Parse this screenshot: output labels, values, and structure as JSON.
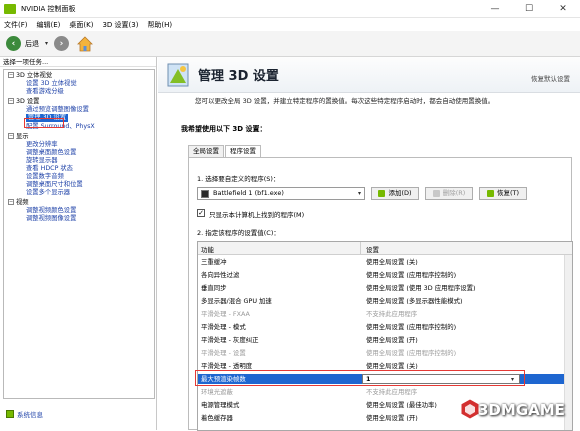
{
  "window": {
    "title": "NVIDIA 控制面板"
  },
  "menu": [
    "文件(F)",
    "编辑(E)",
    "桌面(K)",
    "3D 设置(3)",
    "帮助(H)"
  ],
  "toolbar": {
    "back_label": "后退"
  },
  "sidebar": {
    "header": "选择一项任务...",
    "items": [
      {
        "label": "3D 立体视觉",
        "kind": "cat"
      },
      {
        "label": "设置 3D 立体视觉",
        "kind": "leaf"
      },
      {
        "label": "查看游戏分级",
        "kind": "leaf"
      },
      {
        "label": "3D 设置",
        "kind": "cat"
      },
      {
        "label": "通过预览调整图像设置",
        "kind": "leaf"
      },
      {
        "label": "管理 3D 设置",
        "kind": "selected"
      },
      {
        "label": "配置 Surround、PhysX",
        "kind": "leaf"
      },
      {
        "label": "显示",
        "kind": "cat"
      },
      {
        "label": "更改分辨率",
        "kind": "leaf"
      },
      {
        "label": "调整桌面颜色设置",
        "kind": "leaf"
      },
      {
        "label": "旋转显示器",
        "kind": "leaf"
      },
      {
        "label": "查看 HDCP 状态",
        "kind": "leaf"
      },
      {
        "label": "设置数字音频",
        "kind": "leaf"
      },
      {
        "label": "调整桌面尺寸和位置",
        "kind": "leaf"
      },
      {
        "label": "设置多个显示器",
        "kind": "leaf"
      },
      {
        "label": "视频",
        "kind": "cat"
      },
      {
        "label": "调整视频颜色设置",
        "kind": "leaf"
      },
      {
        "label": "调整视频图像设置",
        "kind": "leaf"
      }
    ],
    "system_info": "系统信息"
  },
  "page": {
    "title": "管理 3D 设置",
    "restore_defaults": "恢复默认设置",
    "description": "您可以更改全局 3D 设置，并建立特定程序的置换值。每次这些特定程序启动时，都会自动使用置换值。",
    "section_title": "我希望使用以下 3D 设置：",
    "tabs": [
      "全局设置",
      "程序设置"
    ],
    "step1_label": "1. 选择要自定义的程序(S)：",
    "program_selected": "Battlefield 1 (bf1.exe)",
    "add_button": "添加(D)",
    "remove_button": "删除(R)",
    "restore_button": "恢复(T)",
    "only_found_checkbox": "只显示本计算机上找到的程序(M)",
    "step2_label": "2. 指定该程序的设置值(C)：",
    "grid_headers": {
      "feature": "功能",
      "setting": "设置"
    },
    "rows": [
      {
        "feature": "三重缓冲",
        "setting": "使用全局设置 (关)",
        "dim": false
      },
      {
        "feature": "各向异性过滤",
        "setting": "使用全局设置 (应用程序控制的)",
        "dim": false
      },
      {
        "feature": "垂直同步",
        "setting": "使用全局设置 (使用 3D 应用程序设置)",
        "dim": false
      },
      {
        "feature": "多显示器/混合 GPU 加速",
        "setting": "使用全局设置 (多显示器性能模式)",
        "dim": false
      },
      {
        "feature": "平滑处理 - FXAA",
        "setting": "不支持此应用程序",
        "dim": true
      },
      {
        "feature": "平滑处理 - 模式",
        "setting": "使用全局设置 (应用程序控制的)",
        "dim": false
      },
      {
        "feature": "平滑处理 - 灰度纠正",
        "setting": "使用全局设置 (开)",
        "dim": false
      },
      {
        "feature": "平滑处理 - 设置",
        "setting": "使用全局设置 (应用程序控制的)",
        "dim": true
      },
      {
        "feature": "平滑处理 - 透明度",
        "setting": "使用全局设置 (关)",
        "dim": false
      },
      {
        "feature": "最大预渲染帧数",
        "setting": "1",
        "dim": false,
        "selected": true
      },
      {
        "feature": "环境光遮蔽",
        "setting": "不支持此应用程序",
        "dim": true
      },
      {
        "feature": "电源管理模式",
        "setting": "使用全局设置 (最佳功率)",
        "dim": false
      },
      {
        "feature": "着色缓存器",
        "setting": "使用全局设置 (开)",
        "dim": false
      }
    ]
  },
  "watermark": {
    "text": "3DMGAME"
  },
  "colors": {
    "nvidia_green": "#76b900",
    "selection_blue": "#1e66d0",
    "annotation_red": "#e53935"
  }
}
